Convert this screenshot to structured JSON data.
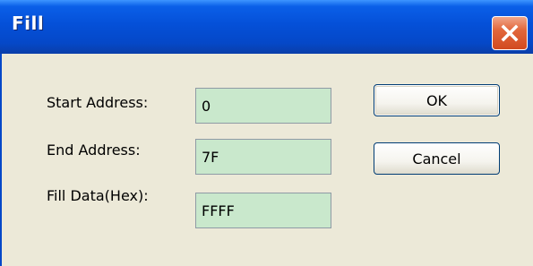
{
  "window": {
    "title": "Fill"
  },
  "fields": [
    {
      "label": "Start Address:",
      "value": "0"
    },
    {
      "label": "End Address:",
      "value": "7F"
    },
    {
      "label": "Fill Data(Hex):",
      "value": "FFFF"
    }
  ],
  "buttons": {
    "ok_label": "OK",
    "cancel_label": "Cancel"
  },
  "icons": {
    "close": "close-icon"
  },
  "colors": {
    "titlebar": "#0550d8",
    "field_background": "#c9e8cc",
    "close_button": "#d14a20",
    "dialog_background": "#ece9d8"
  }
}
